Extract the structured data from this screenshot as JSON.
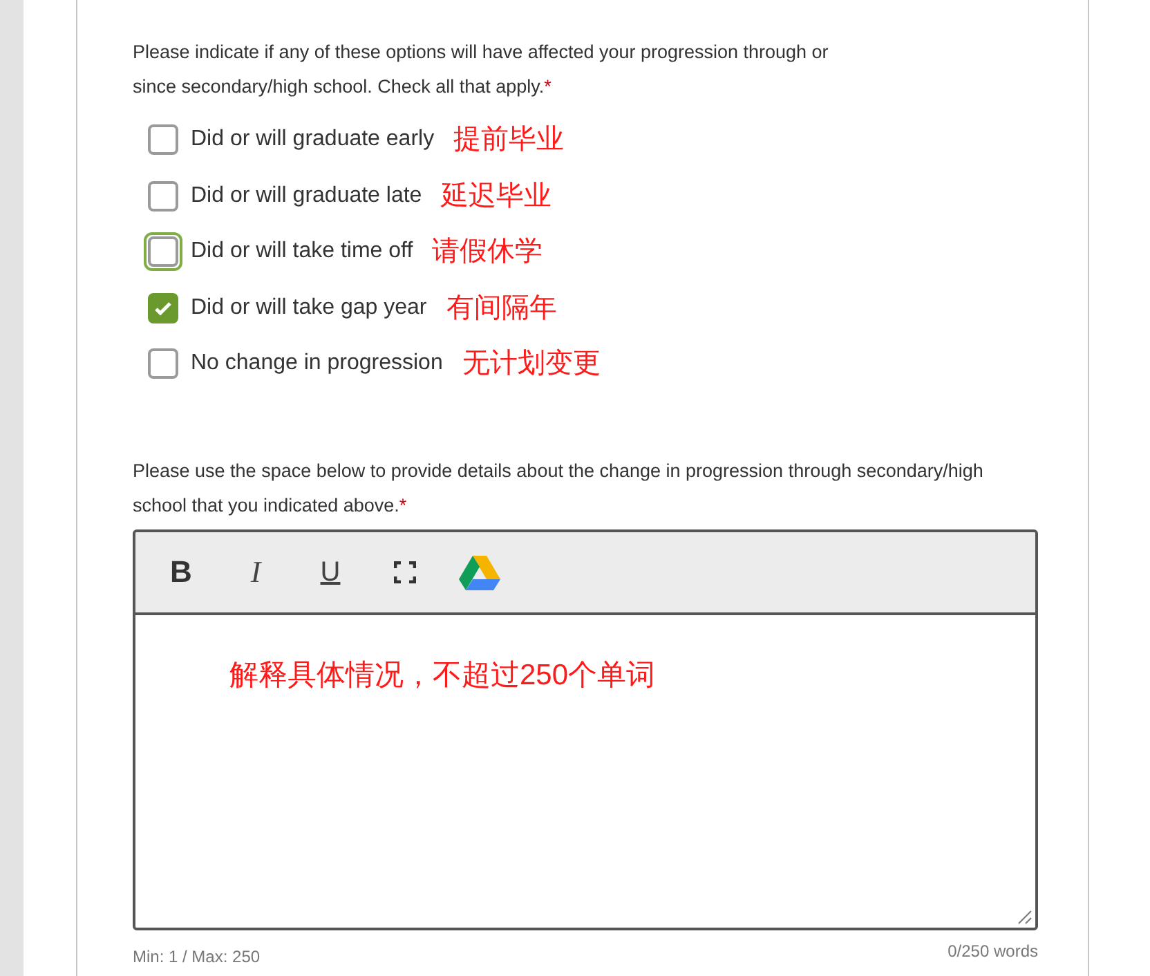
{
  "question_1": {
    "prompt": "Please indicate if any of these options will have affected your progression through or since secondary/high school. Check all that apply.",
    "required_mark": "*",
    "options": [
      {
        "label": "Did or will graduate early",
        "checked": false,
        "focused": false,
        "annotation": "提前毕业"
      },
      {
        "label": "Did or will graduate late",
        "checked": false,
        "focused": false,
        "annotation": "延迟毕业"
      },
      {
        "label": "Did or will take time off",
        "checked": false,
        "focused": true,
        "annotation": "请假休学"
      },
      {
        "label": "Did or will take gap year",
        "checked": true,
        "focused": false,
        "annotation": "有间隔年"
      },
      {
        "label": "No change in progression",
        "checked": false,
        "focused": false,
        "annotation": "无计划变更"
      }
    ]
  },
  "question_2": {
    "prompt": "Please use the space below to provide details about the change in progression through secondary/high school that you indicated above.",
    "required_mark": "*",
    "toolbar": [
      {
        "kind": "bold",
        "label": "B"
      },
      {
        "kind": "italic",
        "label": "I"
      },
      {
        "kind": "underline",
        "label": "U"
      },
      {
        "kind": "fullscreen"
      },
      {
        "kind": "drive"
      }
    ],
    "annotation": "解释具体情况，不超过250个单词",
    "limits": "Min: 1 / Max: 250",
    "word_count": "0/250 words"
  }
}
